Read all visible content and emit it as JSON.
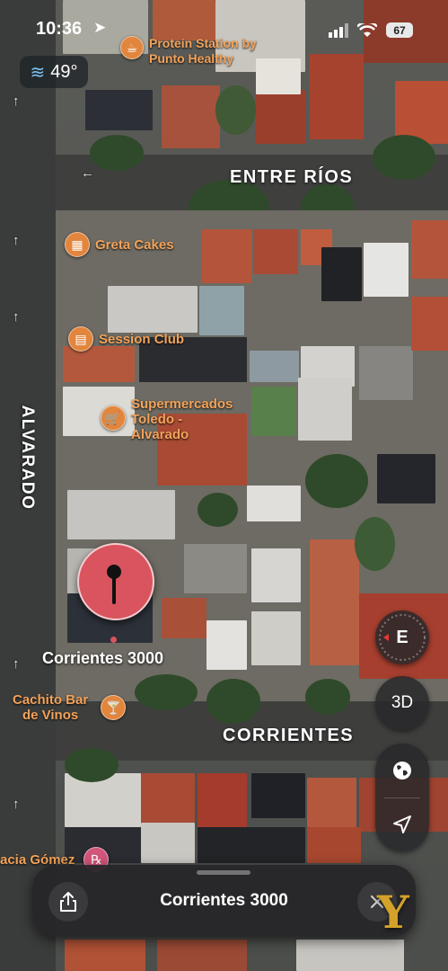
{
  "status_bar": {
    "time": "10:36",
    "battery": "67"
  },
  "weather": {
    "temp": "49°",
    "icon": "wind-icon"
  },
  "streets": {
    "entre_rios": "ENTRE RÍOS",
    "alvarado": "ALVARADO",
    "corrientes": "CORRIENTES"
  },
  "pois": {
    "protein": "Protein Station by Punto Healthy",
    "greta": "Greta Cakes",
    "session": "Session Club",
    "super1": "Supermercados",
    "super2": "Toledo -",
    "super3": "Alvarado",
    "cachito1": "Cachito Bar",
    "cachito2": "de Vinos",
    "gomez": "acia Gómez"
  },
  "pin": {
    "label": "Corrientes 3000"
  },
  "controls": {
    "compass": "E",
    "view_3d": "3D"
  },
  "sheet": {
    "title": "Corrientes 3000"
  },
  "watermark": "Y",
  "colors": {
    "poi_orange": "#e2853d",
    "pin_red": "#d9545f",
    "compass_red": "#e53935"
  }
}
